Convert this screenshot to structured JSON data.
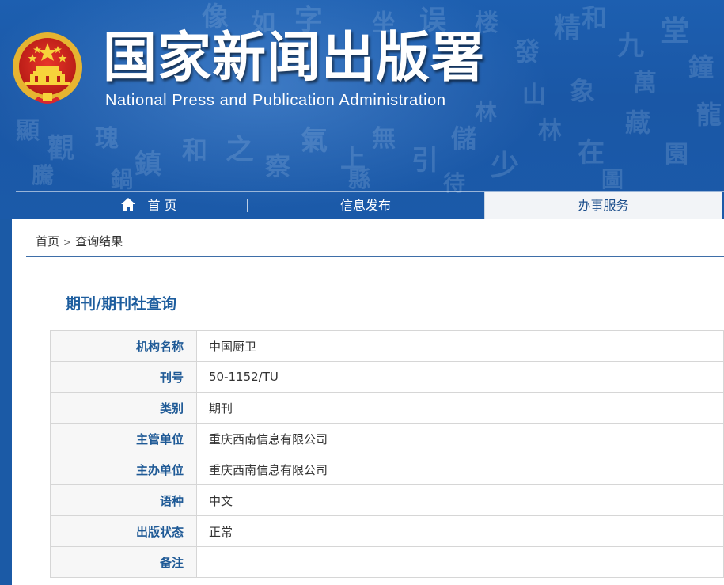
{
  "header": {
    "title_cn": "国家新闻出版署",
    "title_en": "National  Press and Publication Administration",
    "emblem_icon": "national-emblem-icon"
  },
  "nav": {
    "items": [
      {
        "label": "首 页",
        "icon": "home-icon"
      },
      {
        "label": "信息发布"
      },
      {
        "label": "办事服务",
        "active": true
      }
    ]
  },
  "breadcrumb": {
    "home": "首页",
    "separator": ">",
    "current": "查询结果"
  },
  "section": {
    "title": "期刊/期刊社查询"
  },
  "table": {
    "rows": [
      {
        "label": "机构名称",
        "value": "中国厨卫"
      },
      {
        "label": "刊号",
        "value": "50-1152/TU"
      },
      {
        "label": "类别",
        "value": "期刊"
      },
      {
        "label": "主管单位",
        "value": "重庆西南信息有限公司"
      },
      {
        "label": "主办单位",
        "value": "重庆西南信息有限公司"
      },
      {
        "label": "语种",
        "value": "中文"
      },
      {
        "label": "出版状态",
        "value": "正常"
      },
      {
        "label": "备注",
        "value": ""
      }
    ]
  },
  "colors": {
    "banner_blue": "#1b5aa6",
    "label_blue": "#1f5a96",
    "title_blue": "#1d5d9e",
    "active_tab_bg": "#f2f4f7"
  }
}
